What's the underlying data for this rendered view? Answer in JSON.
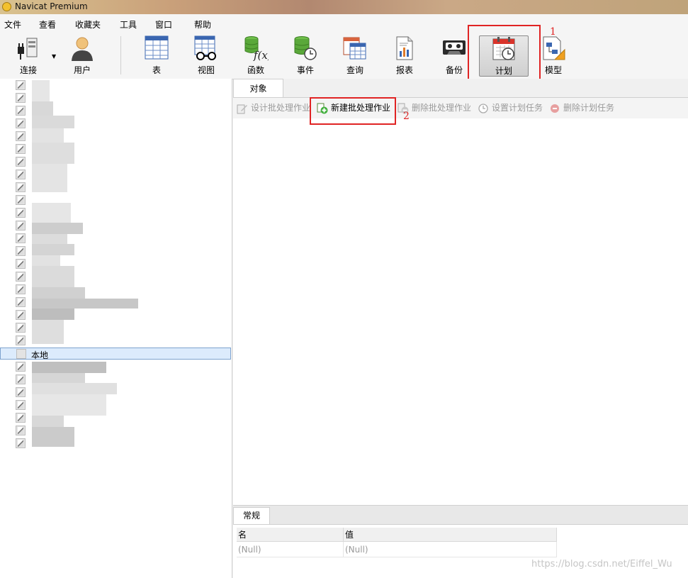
{
  "window": {
    "title": "Navicat Premium"
  },
  "menubar": {
    "items": [
      "文件",
      "查看",
      "收藏夹",
      "工具",
      "窗口",
      "帮助"
    ]
  },
  "toolbar": {
    "connect": "连接",
    "user": "用户",
    "table": "表",
    "view": "视图",
    "function": "函数",
    "event": "事件",
    "query": "查询",
    "report": "报表",
    "backup": "备份",
    "schedule": "计划",
    "model": "模型"
  },
  "annotations": {
    "marker1": "1",
    "marker2": "2"
  },
  "tree": {
    "selected_label": "本地"
  },
  "objects_tab": {
    "label": "对象"
  },
  "object_toolbar": {
    "design_batch": "设计批处理作业",
    "new_batch": "新建批处理作业",
    "delete_batch": "删除批处理作业",
    "set_schedule": "设置计划任务",
    "delete_schedule": "删除计划任务"
  },
  "bottom_tab": {
    "label": "常规"
  },
  "properties": {
    "headers": [
      "名",
      "值"
    ],
    "row": [
      "(Null)",
      "(Null)"
    ]
  },
  "watermark": "https://blog.csdn.net/Eiffel_Wu",
  "colors": {
    "highlight": "#e02424",
    "selected_row": "#dcebfc",
    "green": "#3fae3a"
  }
}
